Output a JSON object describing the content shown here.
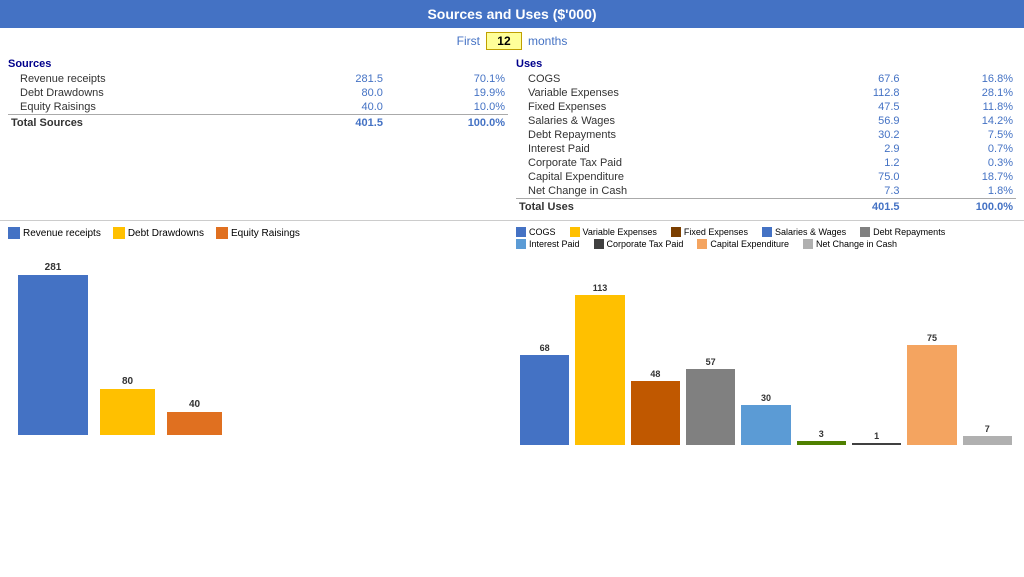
{
  "header": {
    "title": "Sources and Uses ($'000)",
    "first_label": "First",
    "months_value": "12",
    "months_label": "months"
  },
  "sources": {
    "title": "Sources",
    "items": [
      {
        "label": "Revenue receipts",
        "value": "281.5",
        "pct": "70.1%"
      },
      {
        "label": "Debt Drawdowns",
        "value": "80.0",
        "pct": "19.9%"
      },
      {
        "label": "Equity Raisings",
        "value": "40.0",
        "pct": "10.0%"
      }
    ],
    "total_label": "Total Sources",
    "total_value": "401.5",
    "total_pct": "100.0%"
  },
  "uses": {
    "title": "Uses",
    "items": [
      {
        "label": "COGS",
        "value": "67.6",
        "pct": "16.8%"
      },
      {
        "label": "Variable Expenses",
        "value": "112.8",
        "pct": "28.1%"
      },
      {
        "label": "Fixed Expenses",
        "value": "47.5",
        "pct": "11.8%"
      },
      {
        "label": "Salaries & Wages",
        "value": "56.9",
        "pct": "14.2%"
      },
      {
        "label": "Debt Repayments",
        "value": "30.2",
        "pct": "7.5%"
      },
      {
        "label": "Interest Paid",
        "value": "2.9",
        "pct": "0.7%"
      },
      {
        "label": "Corporate Tax Paid",
        "value": "1.2",
        "pct": "0.3%"
      },
      {
        "label": "Capital Expenditure",
        "value": "75.0",
        "pct": "18.7%"
      },
      {
        "label": "Net Change in Cash",
        "value": "7.3",
        "pct": "1.8%"
      }
    ],
    "total_label": "Total Uses",
    "total_value": "401.5",
    "total_pct": "100.0%"
  },
  "left_chart": {
    "legend": [
      {
        "label": "Revenue receipts",
        "color": "#4472C4"
      },
      {
        "label": "Debt Drawdowns",
        "color": "#FFC000"
      },
      {
        "label": "Equity Raisings",
        "color": "#E07020"
      }
    ],
    "bars": [
      {
        "label": "281",
        "value": 281,
        "color": "#4472C4",
        "width": 70
      },
      {
        "label": "80",
        "value": 80,
        "color": "#FFC000",
        "width": 55
      },
      {
        "label": "40",
        "value": 40,
        "color": "#E07020",
        "width": 55
      }
    ],
    "max_value": 281
  },
  "right_chart": {
    "legend": [
      {
        "label": "COGS",
        "color": "#4472C4"
      },
      {
        "label": "Variable Expenses",
        "color": "#FFC000"
      },
      {
        "label": "Fixed Expenses",
        "color": "#7B3F00"
      },
      {
        "label": "Salaries & Wages",
        "color": "#4472C4"
      },
      {
        "label": "Debt Repayments",
        "color": "#808080"
      },
      {
        "label": "Interest Paid",
        "color": "#5B9BD5"
      },
      {
        "label": "Corporate Tax Paid",
        "color": "#404040"
      },
      {
        "label": "Capital Expenditure",
        "color": "#F4A460"
      },
      {
        "label": "Net Change in Cash",
        "color": "#B0B0B0"
      }
    ],
    "bars": [
      {
        "label": "68",
        "value": 68,
        "color": "#4472C4",
        "width": 30
      },
      {
        "label": "113",
        "value": 113,
        "color": "#FFC000",
        "width": 30
      },
      {
        "label": "48",
        "value": 48,
        "color": "#C05800"
      },
      {
        "label": "57",
        "value": 57,
        "color": "#808080"
      },
      {
        "label": "30",
        "value": 30,
        "color": "#5B9BD5"
      },
      {
        "label": "3",
        "value": 3,
        "color": "#4F8000"
      },
      {
        "label": "1",
        "value": 1,
        "color": "#404040"
      },
      {
        "label": "75",
        "value": 75,
        "color": "#F4A460"
      },
      {
        "label": "7",
        "value": 7,
        "color": "#B0B0B0"
      }
    ],
    "max_value": 113
  }
}
